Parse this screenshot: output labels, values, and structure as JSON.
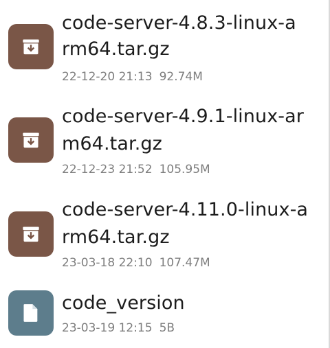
{
  "files": [
    {
      "name_line1": "code-server-4.8.3-linux-a",
      "name_line2": "rm64.tar.gz",
      "date": "22-12-20 21:13",
      "size": "92.74M",
      "icon": "archive-icon",
      "icon_color": "#7a5647"
    },
    {
      "name_line1": "code-server-4.9.1-linux-ar",
      "name_line2": "m64.tar.gz",
      "date": "22-12-23 21:52",
      "size": "105.95M",
      "icon": "archive-icon",
      "icon_color": "#7a5647"
    },
    {
      "name_line1": "code-server-4.11.0-linux-a",
      "name_line2": "rm64.tar.gz",
      "date": "23-03-18 22:10",
      "size": "107.47M",
      "icon": "archive-icon",
      "icon_color": "#7a5647"
    },
    {
      "name_line1": "code_version",
      "date": "23-03-19 12:15",
      "size": "5B",
      "icon": "document-icon",
      "icon_color": "#5d7d8c"
    }
  ]
}
